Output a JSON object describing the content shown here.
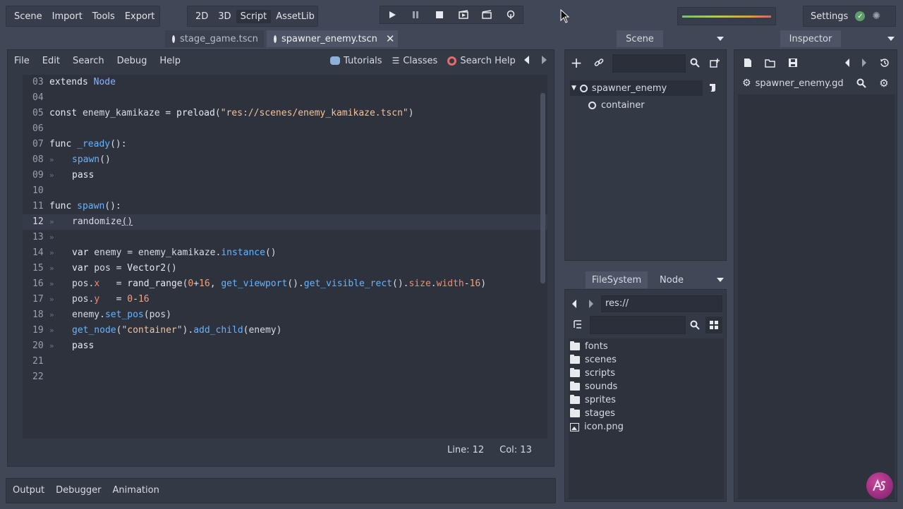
{
  "top_menu": {
    "items": [
      "Scene",
      "Import",
      "Tools",
      "Export"
    ]
  },
  "workspace": {
    "items": [
      "2D",
      "3D",
      "Script",
      "AssetLib"
    ],
    "active": "Script"
  },
  "play_controls": {
    "icons": [
      "play-icon",
      "pause-icon",
      "stop-icon",
      "play-scene-icon",
      "play-custom-scene-icon",
      "remote-debug-icon"
    ]
  },
  "progress": {
    "colors": [
      "#6fc56a",
      "#b6c66a",
      "#d99e58",
      "#d16a5e"
    ]
  },
  "settings": {
    "label": "Settings"
  },
  "scene_tabs": [
    {
      "label": "stage_game.tscn",
      "active": false
    },
    {
      "label": "spawner_enemy.tscn",
      "active": true
    }
  ],
  "script_menu": {
    "items": [
      "File",
      "Edit",
      "Search",
      "Debug",
      "Help"
    ],
    "right": [
      "Tutorials",
      "Classes",
      "Search Help"
    ]
  },
  "code": {
    "lines": [
      {
        "num": "03",
        "text": "extends Node",
        "indent": false
      },
      {
        "num": "04",
        "text": "",
        "indent": false
      },
      {
        "num": "05",
        "text": "const enemy_kamikaze = preload(\"res://scenes/enemy_kamikaze.tscn\")",
        "indent": false
      },
      {
        "num": "06",
        "text": "",
        "indent": false
      },
      {
        "num": "07",
        "text": "func _ready():",
        "indent": false
      },
      {
        "num": "08",
        "text": "spawn()",
        "indent": true
      },
      {
        "num": "09",
        "text": "pass",
        "indent": true
      },
      {
        "num": "10",
        "text": "",
        "indent": false
      },
      {
        "num": "11",
        "text": "func spawn():",
        "indent": false
      },
      {
        "num": "12",
        "text": "randomize()",
        "indent": true,
        "current": true
      },
      {
        "num": "13",
        "text": "",
        "indent": true
      },
      {
        "num": "14",
        "text": "var enemy = enemy_kamikaze.instance()",
        "indent": true
      },
      {
        "num": "15",
        "text": "var pos = Vector2()",
        "indent": true
      },
      {
        "num": "16",
        "text": "pos.x   = rand_range(0+16, get_viewport().get_visible_rect().size.width-16)",
        "indent": true
      },
      {
        "num": "17",
        "text": "pos.y   = 0-16",
        "indent": true
      },
      {
        "num": "18",
        "text": "enemy.set_pos(pos)",
        "indent": true
      },
      {
        "num": "19",
        "text": "get_node(\"container\").add_child(enemy)",
        "indent": true
      },
      {
        "num": "20",
        "text": "pass",
        "indent": true
      },
      {
        "num": "21",
        "text": "",
        "indent": false
      },
      {
        "num": "22",
        "text": "",
        "indent": false
      }
    ]
  },
  "status": {
    "line": "Line: 12",
    "col": "Col: 13"
  },
  "bottom_tabs": [
    "Output",
    "Debugger",
    "Animation"
  ],
  "scene_dock": {
    "tab": "Scene",
    "root": "spawner_enemy",
    "child": "container"
  },
  "filesystem": {
    "tabs": [
      "FileSystem",
      "Node"
    ],
    "path": "res://",
    "items": [
      {
        "name": "fonts",
        "type": "folder"
      },
      {
        "name": "scenes",
        "type": "folder"
      },
      {
        "name": "scripts",
        "type": "folder"
      },
      {
        "name": "sounds",
        "type": "folder"
      },
      {
        "name": "sprites",
        "type": "folder"
      },
      {
        "name": "stages",
        "type": "folder"
      },
      {
        "name": "icon.png",
        "type": "image"
      }
    ]
  },
  "inspector": {
    "tab": "Inspector",
    "resource": "spawner_enemy.gd"
  }
}
